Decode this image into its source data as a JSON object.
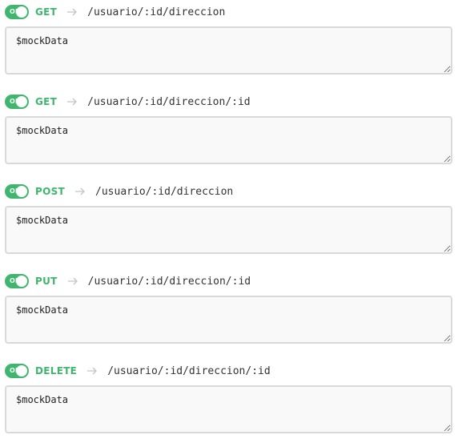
{
  "endpoints": [
    {
      "toggle_label": "ON",
      "method": "GET",
      "path": "/usuario/:id/direccion",
      "body": "$mockData"
    },
    {
      "toggle_label": "ON",
      "method": "GET",
      "path": "/usuario/:id/direccion/:id",
      "body": "$mockData"
    },
    {
      "toggle_label": "ON",
      "method": "POST",
      "path": "/usuario/:id/direccion",
      "body": "$mockData"
    },
    {
      "toggle_label": "ON",
      "method": "PUT",
      "path": "/usuario/:id/direccion/:id",
      "body": "$mockData"
    },
    {
      "toggle_label": "ON",
      "method": "DELETE",
      "path": "/usuario/:id/direccion/:id",
      "body": "$mockData"
    }
  ],
  "icons": {
    "arrow": "arrow-right-icon"
  },
  "colors": {
    "accent": "#3fb66d",
    "arrow": "#c4c4c4",
    "border": "#d9d9d9"
  }
}
